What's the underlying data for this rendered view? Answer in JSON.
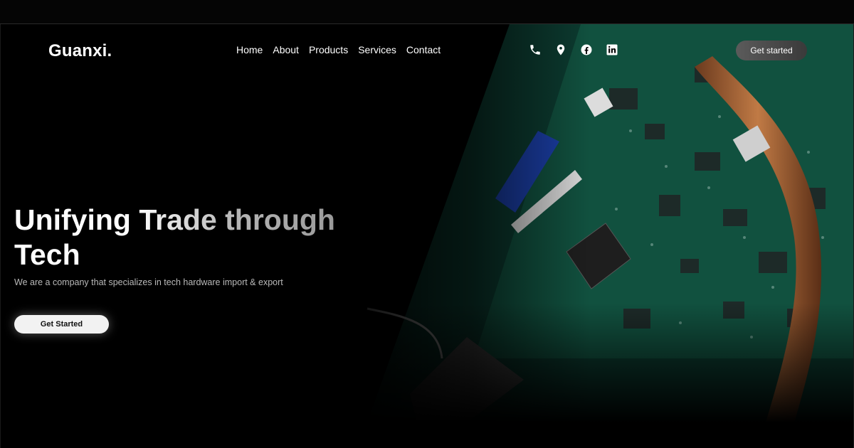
{
  "brand": {
    "logo": "Guanxi."
  },
  "nav": {
    "items": [
      {
        "label": "Home"
      },
      {
        "label": "About"
      },
      {
        "label": "Products"
      },
      {
        "label": "Services"
      },
      {
        "label": "Contact"
      }
    ]
  },
  "header_icons": [
    "phone-icon",
    "location-pin-icon",
    "facebook-icon",
    "linkedin-icon"
  ],
  "header_cta": {
    "label": "Get started"
  },
  "hero": {
    "headline": "Unifying Trade through Tech",
    "subtitle": "We are a company that specializes in tech hardware import & export",
    "cta_label": "Get Started",
    "image": "circuit-board-photo"
  },
  "colors": {
    "background": "#000000",
    "text": "#ffffff",
    "muted_text": "#b9b9b9",
    "cta_light": "#f2f2f2",
    "cta_dark": "#4a4a4a",
    "pcb_green": "#0f4a3a"
  }
}
